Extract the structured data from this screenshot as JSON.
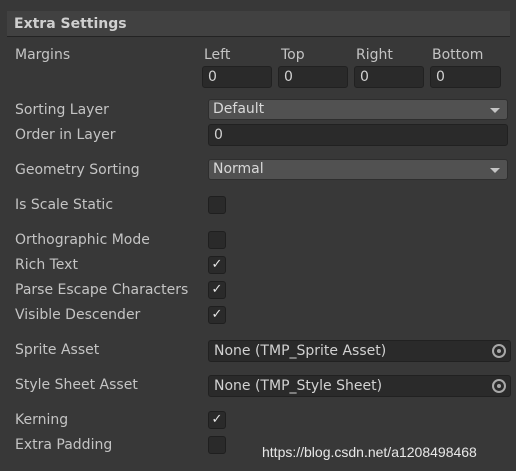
{
  "section": {
    "title": "Extra Settings"
  },
  "margins": {
    "label": "Margins",
    "left_label": "Left",
    "top_label": "Top",
    "right_label": "Right",
    "bottom_label": "Bottom",
    "left": "0",
    "top": "0",
    "right": "0",
    "bottom": "0"
  },
  "sorting_layer": {
    "label": "Sorting Layer",
    "value": "Default"
  },
  "order_in_layer": {
    "label": "Order in Layer",
    "value": "0"
  },
  "geometry_sorting": {
    "label": "Geometry Sorting",
    "value": "Normal"
  },
  "toggles": {
    "is_scale_static": {
      "label": "Is Scale Static",
      "mark": ""
    },
    "orthographic_mode": {
      "label": "Orthographic Mode",
      "mark": ""
    },
    "rich_text": {
      "label": "Rich Text",
      "mark": "✓"
    },
    "parse_escape": {
      "label": "Parse Escape Characters",
      "mark": "✓"
    },
    "visible_descender": {
      "label": "Visible Descender",
      "mark": "✓"
    },
    "kerning": {
      "label": "Kerning",
      "mark": "✓"
    },
    "extra_padding": {
      "label": "Extra Padding",
      "mark": ""
    }
  },
  "sprite_asset": {
    "label": "Sprite Asset",
    "value": "None (TMP_Sprite Asset)"
  },
  "style_sheet_asset": {
    "label": "Style Sheet Asset",
    "value": "None (TMP_Style Sheet)"
  },
  "watermark": "https://blog.csdn.net/a1208498468"
}
